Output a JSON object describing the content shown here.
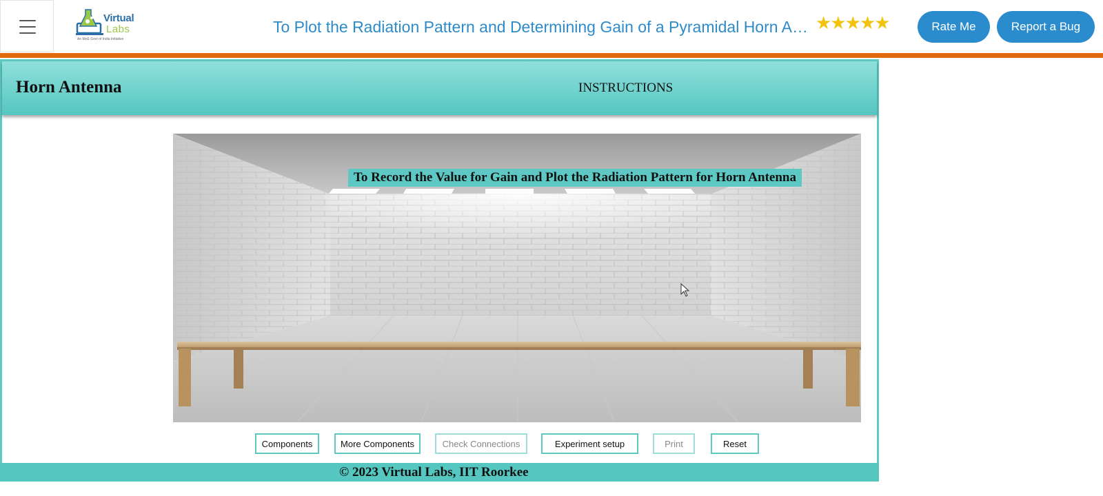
{
  "nav": {
    "logo_word1": "Virtual",
    "logo_word2": "Labs",
    "logo_tagline": "An MoE Govt of India Initiative",
    "title": "To Plot the Radiation Pattern and Determining Gain of a Pyramidal Horn Antenna",
    "stars": "★★★★★",
    "rate_label": "Rate Me",
    "bug_label": "Report a Bug"
  },
  "panel": {
    "title": "Horn Antenna",
    "instructions_label": "INSTRUCTIONS"
  },
  "scene": {
    "caption": "To Record the Value for Gain and Plot the Radiation Pattern for Horn Antenna"
  },
  "controls": {
    "components": "Components",
    "more_components": "More Components",
    "check_connections": "Check Connections",
    "experiment_setup": "Experiment setup",
    "print": "Print",
    "reset": "Reset"
  },
  "footer": {
    "copyright": "© 2023 Virtual Labs, IIT Roorkee"
  },
  "colors": {
    "accent_teal": "#5ec8c4",
    "accent_orange": "#e36a0c",
    "button_blue": "#2b8ccd",
    "title_blue": "#2e8bc9"
  }
}
